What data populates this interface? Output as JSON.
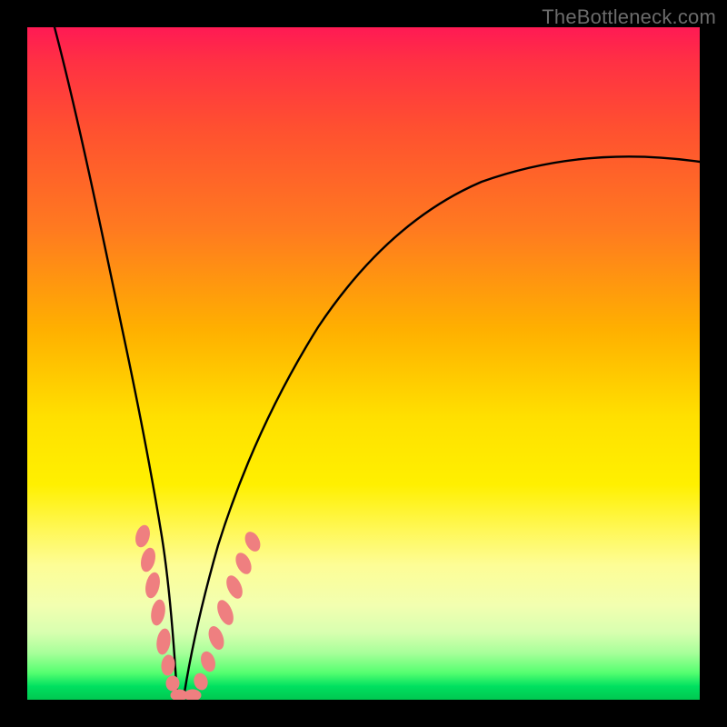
{
  "watermark": {
    "text": "TheBottleneck.com"
  },
  "chart_data": {
    "type": "line",
    "title": "",
    "xlabel": "",
    "ylabel": "",
    "xlim": [
      0,
      100
    ],
    "ylim": [
      0,
      100
    ],
    "gradient_stops": [
      {
        "pct": 0,
        "color": "#ff1a54"
      },
      {
        "pct": 5,
        "color": "#ff3044"
      },
      {
        "pct": 15,
        "color": "#ff5030"
      },
      {
        "pct": 30,
        "color": "#ff7a20"
      },
      {
        "pct": 45,
        "color": "#ffb000"
      },
      {
        "pct": 58,
        "color": "#ffe000"
      },
      {
        "pct": 68,
        "color": "#fff000"
      },
      {
        "pct": 75,
        "color": "#fff85a"
      },
      {
        "pct": 80,
        "color": "#fdfd96"
      },
      {
        "pct": 86,
        "color": "#f2ffb0"
      },
      {
        "pct": 90,
        "color": "#d8ffb0"
      },
      {
        "pct": 93,
        "color": "#a8ff9a"
      },
      {
        "pct": 96,
        "color": "#55ff70"
      },
      {
        "pct": 98,
        "color": "#00e060"
      },
      {
        "pct": 100,
        "color": "#00c850"
      }
    ],
    "series": [
      {
        "name": "bottleneck-curve",
        "note": "V-shaped curve; y is bottleneck % (0 at bottom, 100 at top). Minimum around x≈22.",
        "x": [
          4,
          6,
          8,
          10,
          12,
          14,
          16,
          18,
          20,
          21,
          22,
          23,
          24,
          26,
          28,
          30,
          34,
          38,
          44,
          52,
          60,
          70,
          80,
          90,
          100
        ],
        "y": [
          100,
          86,
          72,
          59,
          47,
          36,
          26,
          17,
          8,
          3,
          0,
          1,
          3,
          8,
          14,
          20,
          30,
          38,
          48,
          57,
          64,
          70,
          75,
          78,
          80
        ]
      }
    ],
    "markers": {
      "name": "highlighted-points",
      "color": "#ef7f80",
      "points": [
        {
          "x": 16.5,
          "y": 24
        },
        {
          "x": 17.2,
          "y": 20
        },
        {
          "x": 17.8,
          "y": 17
        },
        {
          "x": 18.5,
          "y": 13
        },
        {
          "x": 19.2,
          "y": 9
        },
        {
          "x": 20.0,
          "y": 5
        },
        {
          "x": 21.0,
          "y": 2
        },
        {
          "x": 22.0,
          "y": 0
        },
        {
          "x": 23.0,
          "y": 0.5
        },
        {
          "x": 24.0,
          "y": 2
        },
        {
          "x": 25.0,
          "y": 5
        },
        {
          "x": 26.0,
          "y": 8
        },
        {
          "x": 27.0,
          "y": 12
        },
        {
          "x": 28.0,
          "y": 15
        },
        {
          "x": 29.0,
          "y": 18
        },
        {
          "x": 30.0,
          "y": 21
        },
        {
          "x": 31.0,
          "y": 24
        }
      ]
    }
  }
}
